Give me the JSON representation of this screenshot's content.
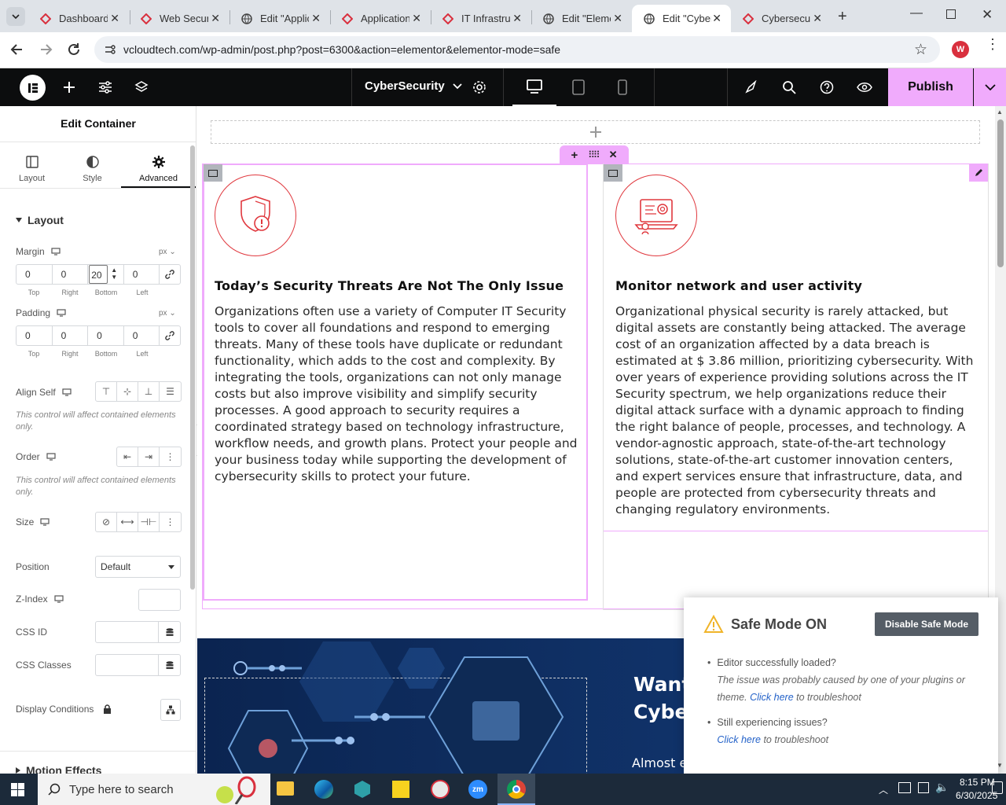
{
  "browser": {
    "tabs": [
      {
        "title": "Dashboard",
        "favicon": "wp-red-icon",
        "active": false
      },
      {
        "title": "Web Security",
        "favicon": "wp-red-icon",
        "active": false
      },
      {
        "title": "Edit \"Application",
        "favicon": "globe-icon",
        "active": false
      },
      {
        "title": "Application",
        "favicon": "wp-red-icon",
        "active": false
      },
      {
        "title": "IT Infrastructure",
        "favicon": "wp-red-icon",
        "active": false
      },
      {
        "title": "Edit \"Elementor",
        "favicon": "globe-icon",
        "active": false
      },
      {
        "title": "Edit \"CyberSecurity",
        "favicon": "globe-icon",
        "active": true
      },
      {
        "title": "Cybersecurity",
        "favicon": "wp-red-icon",
        "active": false
      }
    ],
    "url": "vcloudtech.com/wp-admin/post.php?post=6300&action=elementor&elementor-mode=safe",
    "profile_initial": "W"
  },
  "elementor_bar": {
    "page_name": "CyberSecurity",
    "publish_label": "Publish"
  },
  "panel": {
    "title": "Edit Container",
    "tabs": [
      {
        "label": "Layout"
      },
      {
        "label": "Style"
      },
      {
        "label": "Advanced"
      }
    ],
    "section_layout": "Layout",
    "margin": {
      "label": "Margin",
      "unit": "px",
      "values": [
        "0",
        "0",
        "20",
        "0"
      ]
    },
    "padding": {
      "label": "Padding",
      "unit": "px",
      "values": [
        "0",
        "0",
        "0",
        "0"
      ]
    },
    "side_labels": [
      "Top",
      "Right",
      "Bottom",
      "Left"
    ],
    "align_self_label": "Align Self",
    "align_note": "This control will affect contained elements only.",
    "order_label": "Order",
    "order_note": "This control will affect contained elements only.",
    "size_label": "Size",
    "position_label": "Position",
    "position_value": "Default",
    "zindex_label": "Z-Index",
    "cssid_label": "CSS ID",
    "cssclasses_label": "CSS Classes",
    "display_conditions_label": "Display Conditions",
    "motion_effects_label": "Motion Effects"
  },
  "canvas": {
    "card1": {
      "title": "Today’s Security Threats Are Not The Only Issue",
      "body": "Organizations often use a variety of Computer IT Security tools to cover all foundations and respond to emerging threats. Many of these tools have duplicate or redundant functionality, which adds to the cost and complexity. By integrating the tools, organizations can not only manage costs but also improve visibility and simplify security processes. A good approach to security requires a coordinated strategy based on technology infrastructure, workflow needs, and growth plans. Protect your people and your business today while supporting the development of cybersecurity skills to protect your future."
    },
    "card2": {
      "title": "Monitor network and user activity",
      "body": "Organizational physical security is rarely attacked, but digital assets are constantly being attacked. The average cost of an organization affected by a data breach is estimated at $ 3.86 million, prioritizing cybersecurity. With over years of experience providing solutions across the IT Security spectrum, we help organizations reduce their digital attack surface with a dynamic approach to finding the right balance of people, processes, and technology. A vendor-agnostic approach, state-of-the-art technology solutions, state-of-the-art customer innovation centers, and expert services ensure that infrastructure, data, and people are protected from cybersecurity threats and changing regulatory environments."
    },
    "banner": {
      "heading_line1": "Want",
      "heading_line2": "Cyber",
      "subtext": "Almost everything you do for your business is done"
    }
  },
  "safe_mode": {
    "title": "Safe Mode ON",
    "button": "Disable Safe Mode",
    "item1_title": "Editor successfully loaded?",
    "item1_text_a": "The issue was probably caused by one of your plugins or theme.",
    "item1_link": "Click here",
    "item1_text_b": "to troubleshoot",
    "item2_title": "Still experiencing issues?",
    "item2_link": "Click here",
    "item2_text": "to troubleshoot"
  },
  "taskbar": {
    "search_placeholder": "Type here to search",
    "time": "8:15 PM",
    "date": "6/30/2025"
  },
  "colors": {
    "accent_pink": "#f0abfc",
    "icon_red": "#e0383e",
    "elementor_dark": "#0c0d0e",
    "link_blue": "#2563c9"
  }
}
